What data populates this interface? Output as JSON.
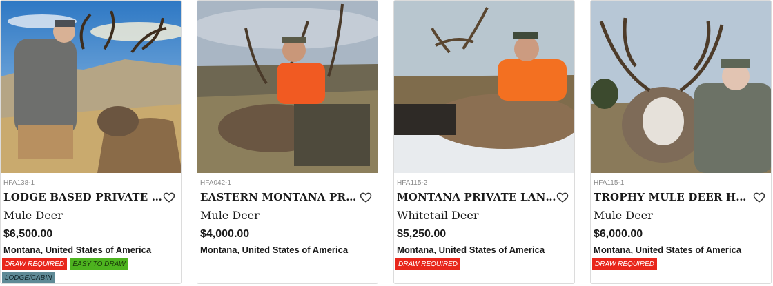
{
  "listings": [
    {
      "sku": "HFA138-1",
      "title": "LODGE BASED PRIVATE LAND MULE DEER HUNT",
      "species": "Mule Deer",
      "price": "$6,500.00",
      "location": "Montana, United States of America",
      "tags": [
        {
          "label": "DRAW REQUIRED",
          "color": "#e8261b"
        },
        {
          "label": "EASY TO DRAW",
          "color": "#4db31f"
        },
        {
          "label": "LODGE/CABIN",
          "color": "#5f8a96"
        }
      ]
    },
    {
      "sku": "HFA042-1",
      "title": "EASTERN MONTANA PRIVATE LAND MULE DEER HUNT",
      "species": "Mule Deer",
      "price": "$4,000.00",
      "location": "Montana, United States of America",
      "tags": []
    },
    {
      "sku": "HFA115-2",
      "title": "MONTANA PRIVATE LAND TROPHY WHITETAIL HUNT",
      "species": "Whitetail Deer",
      "price": "$5,250.00",
      "location": "Montana, United States of America",
      "tags": [
        {
          "label": "DRAW REQUIRED",
          "color": "#e8261b"
        }
      ]
    },
    {
      "sku": "HFA115-1",
      "title": "TROPHY MULE DEER HUNT IN MONTANA",
      "species": "Mule Deer",
      "price": "$6,000.00",
      "location": "Montana, United States of America",
      "tags": [
        {
          "label": "DRAW REQUIRED",
          "color": "#e8261b"
        }
      ]
    }
  ],
  "icons": {
    "favorite": "heart-outline-icon"
  }
}
